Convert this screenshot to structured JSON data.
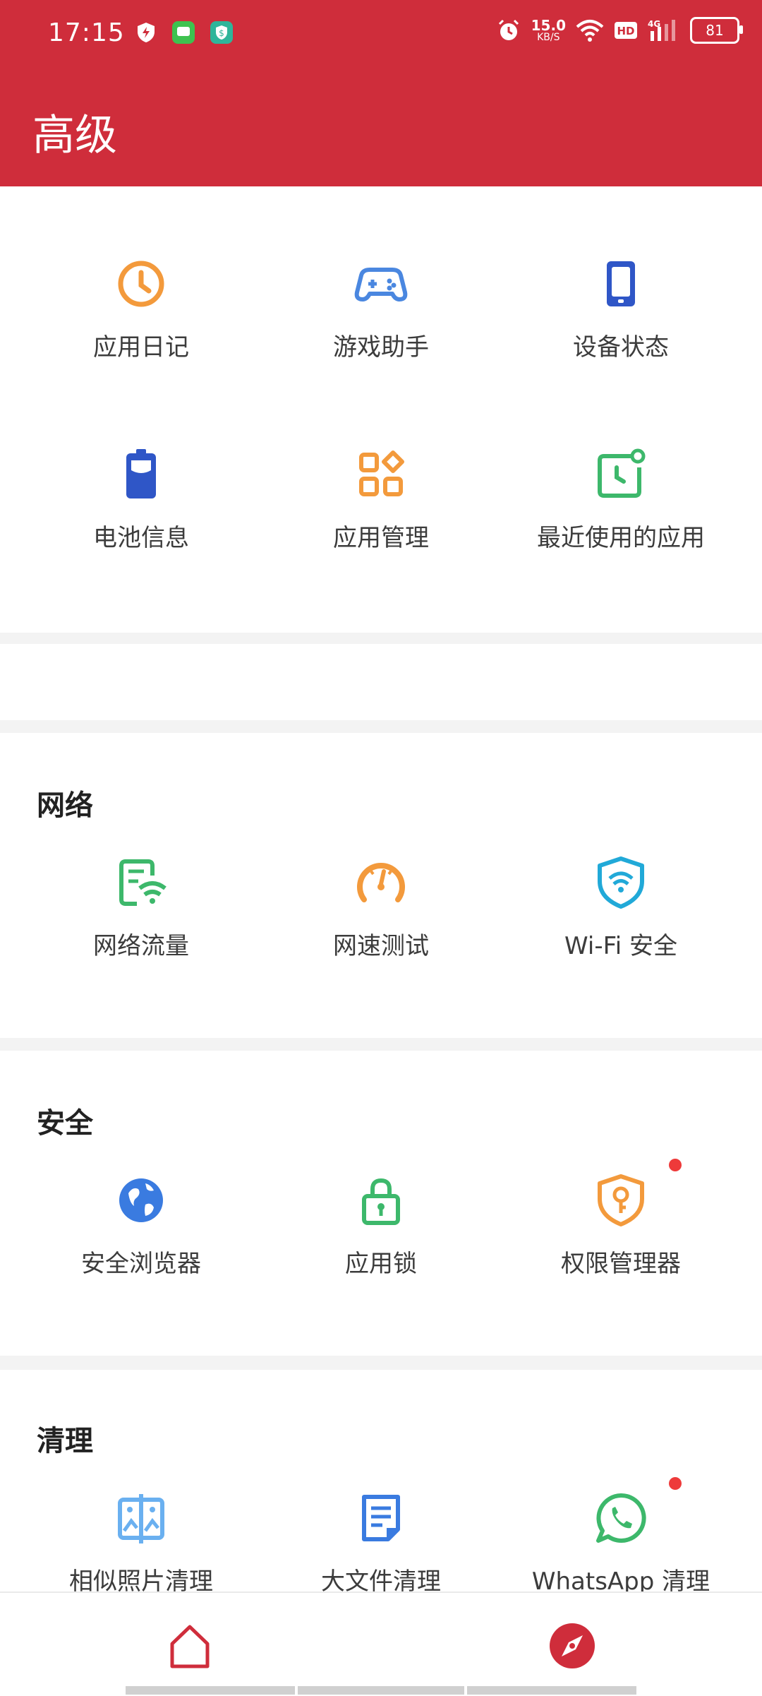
{
  "status_bar": {
    "time": "17:15",
    "speed_value": "15.0",
    "speed_unit": "KB/S",
    "battery": "81"
  },
  "header": {
    "title": "高级"
  },
  "tools": [
    {
      "label": "应用日记",
      "icon": "clock-icon"
    },
    {
      "label": "游戏助手",
      "icon": "gamepad-icon"
    },
    {
      "label": "设备状态",
      "icon": "phone-icon"
    },
    {
      "label": "电池信息",
      "icon": "battery-icon"
    },
    {
      "label": "应用管理",
      "icon": "apps-grid-icon"
    },
    {
      "label": "最近使用的应用",
      "icon": "recent-clock-icon"
    }
  ],
  "network": {
    "title": "网络",
    "items": [
      {
        "label": "网络流量",
        "icon": "data-usage-icon"
      },
      {
        "label": "网速测试",
        "icon": "speedometer-icon"
      },
      {
        "label": "Wi-Fi 安全",
        "icon": "wifi-shield-icon"
      }
    ]
  },
  "security": {
    "title": "安全",
    "items": [
      {
        "label": "安全浏览器",
        "icon": "browser-globe-icon"
      },
      {
        "label": "应用锁",
        "icon": "lock-icon"
      },
      {
        "label": "权限管理器",
        "icon": "key-shield-icon"
      }
    ]
  },
  "clean": {
    "title": "清理",
    "items": [
      {
        "label": "相似照片清理",
        "icon": "similar-photos-icon"
      },
      {
        "label": "大文件清理",
        "icon": "large-file-icon"
      },
      {
        "label": "WhatsApp 清理",
        "icon": "whatsapp-icon"
      }
    ]
  },
  "colors": {
    "brand_red": "#cf2d3b",
    "orange": "#f39a3c",
    "blue": "#4a87e0",
    "dark_blue": "#2f56c7",
    "green": "#3db86b",
    "cyan": "#21a9d8"
  }
}
